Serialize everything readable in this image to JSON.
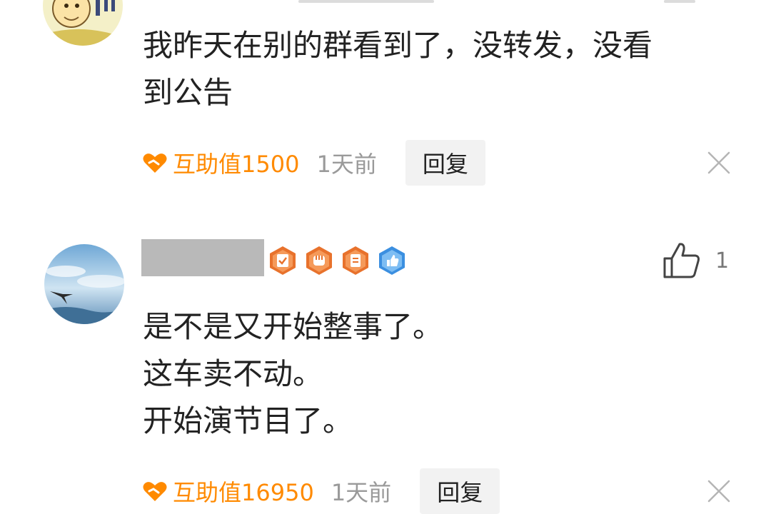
{
  "comments": [
    {
      "text_lines": [
        "我昨天在别的群看到了，没转发，没看",
        "到公告"
      ],
      "help_value": "互助值1500",
      "time": "1天前",
      "reply_label": "回复"
    },
    {
      "text_lines": [
        "是不是又开始整事了。",
        "这车卖不动。",
        "开始演节目了。"
      ],
      "like_count": "1",
      "help_value": "互助值16950",
      "time": "1天前",
      "reply_label": "回复"
    }
  ],
  "colors": {
    "accent": "#ff8a00",
    "muted_text": "#9a9a9a",
    "reply_bg": "#f2f2f2",
    "badge_orange": "#e8722c",
    "badge_blue": "#3b8fe0"
  },
  "icons": {
    "help_value": "heart-handshake-icon",
    "like": "thumbs-up-icon",
    "close": "close-icon",
    "badges": [
      "clipboard-check-badge-icon",
      "fist-badge-icon",
      "document-badge-icon",
      "thumbs-up-badge-icon"
    ]
  }
}
